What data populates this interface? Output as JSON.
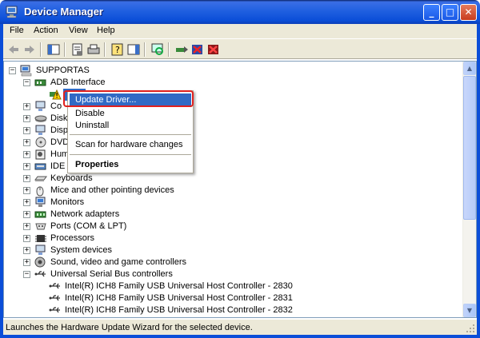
{
  "window": {
    "title": "Device Manager",
    "controls": {
      "minimize": "_",
      "maximize": "□",
      "close": "✕"
    }
  },
  "menu": [
    "File",
    "Action",
    "View",
    "Help"
  ],
  "toolbar": {
    "icons": [
      "back-arrow-icon",
      "forward-arrow-icon",
      "show-hide-console-tree-icon",
      "properties-icon",
      "print-icon",
      "help-icon",
      "show-hide-action-pane-icon",
      "scan-hardware-icon",
      "update-driver-icon",
      "uninstall-icon",
      "disable-icon"
    ]
  },
  "tree": {
    "root": "SUPPORTAS",
    "adb_interface": "ADB Interface",
    "categories_partial": [
      "Co",
      "Disk",
      "Disp",
      "DVD",
      "Hum",
      "IDE"
    ],
    "categories": [
      "Keyboards",
      "Mice and other pointing devices",
      "Monitors",
      "Network adapters",
      "Ports (COM & LPT)",
      "Processors",
      "System devices",
      "Sound, video and game controllers",
      "Universal Serial Bus controllers"
    ],
    "usb_children": [
      "Intel(R) ICH8 Family USB Universal Host Controller - 2830",
      "Intel(R) ICH8 Family USB Universal Host Controller - 2831",
      "Intel(R) ICH8 Family USB Universal Host Controller - 2832"
    ],
    "expander_plus": "+",
    "expander_minus": "−"
  },
  "context_menu": {
    "update_driver": "Update Driver...",
    "disable": "Disable",
    "uninstall": "Uninstall",
    "scan": "Scan for hardware changes",
    "properties": "Properties"
  },
  "status": {
    "text": "Launches the Hardware Update Wizard for the selected device."
  },
  "colors": {
    "title_blue": "#0b4ed8",
    "selection": "#316ac5",
    "highlight_ring": "#e0201e",
    "chrome": "#ece9d8"
  }
}
